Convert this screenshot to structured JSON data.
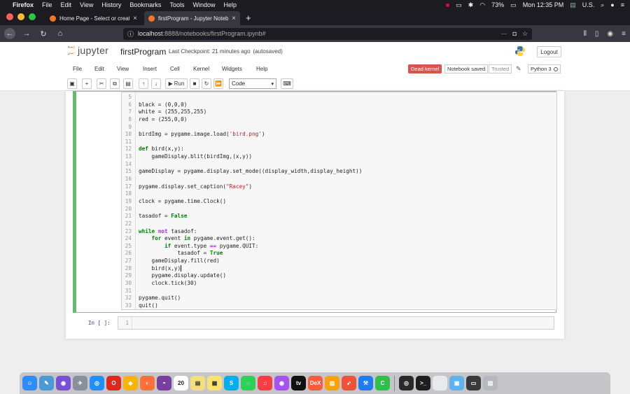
{
  "menubar": {
    "app": "Firefox",
    "items": [
      "File",
      "Edit",
      "View",
      "History",
      "Bookmarks",
      "Tools",
      "Window",
      "Help"
    ],
    "battery": "73%",
    "clock": "Mon 12:35 PM",
    "locale": "U.S."
  },
  "tabs": [
    {
      "label": "Home Page - Select or create a",
      "active": false
    },
    {
      "label": "firstProgram - Jupyter Noteboo",
      "active": true
    }
  ],
  "address": {
    "host": "localhost",
    "path": ":8888/notebooks/firstProgram.ipynb#"
  },
  "jupyter": {
    "logo_text": "jupyter",
    "notebook_name": "firstProgram",
    "checkpoint": "Last Checkpoint: 21 minutes ago",
    "autosave": "(autosaved)",
    "logout_label": "Logout"
  },
  "nbmenu": {
    "items": [
      "File",
      "Edit",
      "View",
      "Insert",
      "Cell",
      "Kernel",
      "Widgets",
      "Help"
    ],
    "dead_kernel": "Dead kernel",
    "notebook_saved": "Notebook saved",
    "trusted": "Trusted",
    "kernel_name": "Python 3"
  },
  "toolbar": {
    "run_label": "Run",
    "cell_type": "Code"
  },
  "cell1": {
    "lines": [
      {
        "n": "5",
        "code": ""
      },
      {
        "n": "6",
        "code": "black = (0,0,0)"
      },
      {
        "n": "7",
        "code": "white = (255,255,255)"
      },
      {
        "n": "8",
        "code": "red = (255,0,0)"
      },
      {
        "n": "9",
        "code": ""
      },
      {
        "n": "10",
        "code": "birdImg = pygame.image.load('bird.png')"
      },
      {
        "n": "11",
        "code": ""
      },
      {
        "n": "12",
        "code": "def bird(x,y):"
      },
      {
        "n": "13",
        "code": "    gameDisplay.blit(birdImg,(x,y))"
      },
      {
        "n": "14",
        "code": ""
      },
      {
        "n": "15",
        "code": "gameDisplay = pygame.display.set_mode((display_width,display_height))"
      },
      {
        "n": "16",
        "code": ""
      },
      {
        "n": "17",
        "code": "pygame.display.set_caption(\"Racey\")"
      },
      {
        "n": "18",
        "code": ""
      },
      {
        "n": "19",
        "code": "clock = pygame.time.Clock()"
      },
      {
        "n": "20",
        "code": ""
      },
      {
        "n": "21",
        "code": "tasadof = False"
      },
      {
        "n": "22",
        "code": ""
      },
      {
        "n": "23",
        "code": "while not tasadof:"
      },
      {
        "n": "24",
        "code": "    for event in pygame.event.get():"
      },
      {
        "n": "25",
        "code": "        if event.type == pygame.QUIT:"
      },
      {
        "n": "26",
        "code": "            tasadof = True"
      },
      {
        "n": "27",
        "code": "    gameDisplay.fill(red)"
      },
      {
        "n": "28",
        "code": "    bird(x,y)"
      },
      {
        "n": "29",
        "code": "    pygame.display.update()"
      },
      {
        "n": "30",
        "code": "    clock.tick(30)"
      },
      {
        "n": "31",
        "code": ""
      },
      {
        "n": "32",
        "code": "pygame.quit()"
      },
      {
        "n": "33",
        "code": "quit()"
      }
    ]
  },
  "cell2": {
    "prompt": "In [ ]:",
    "line_number": "1"
  },
  "dock": {
    "apps": [
      "Finder",
      "Preview",
      "Siri",
      "Launchpad",
      "Safari",
      "Opera",
      "Sketch",
      "Firefox",
      "GitHub",
      "Calendar",
      "Stickies",
      "Notes",
      "Skype",
      "Messages",
      "Music",
      "Podcasts",
      "TV",
      "DeX",
      "Books",
      "Swift",
      "Xcode",
      "Camtasia",
      "QuickTime",
      "Terminal",
      "Python",
      "Folder",
      "Window",
      "Trash"
    ],
    "calendar_day": "20"
  },
  "colors": {
    "dead_kernel": "#d9534f",
    "cell_selected_border": "#66bb6a",
    "keyword": "#008000",
    "string": "#ba2121"
  }
}
